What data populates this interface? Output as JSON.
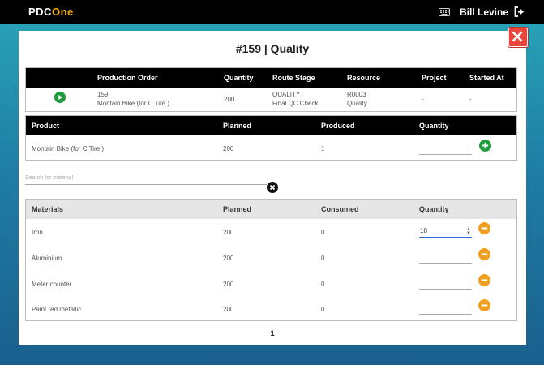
{
  "app": {
    "logo_left": "PDC",
    "logo_right": "One",
    "user_name": "Bill Levine"
  },
  "modal": {
    "title": "#159 | Quality"
  },
  "order_table": {
    "headers": [
      "Production Order",
      "Quantity",
      "Route Stage",
      "Resource",
      "Project",
      "Started At"
    ],
    "row": {
      "order_id": "159",
      "order_name": "Montain Bike (for C.Tire )",
      "quantity": "200",
      "route_stage_1": "QUALITY",
      "route_stage_2": "Final QC Check",
      "resource_1": "R0003",
      "resource_2": "Quality",
      "project": "-",
      "started_at": "-"
    }
  },
  "product_table": {
    "headers": [
      "Product",
      "Planned",
      "Produced",
      "Quantity"
    ],
    "row": {
      "product": "Montain Bike (for C.Tire )",
      "planned": "200",
      "produced": "1",
      "quantity": ""
    }
  },
  "search": {
    "placeholder": "Search for material"
  },
  "materials_table": {
    "headers": [
      "Materials",
      "Planned",
      "Consumed",
      "Quantity"
    ],
    "rows": [
      {
        "material": "Iron",
        "planned": "200",
        "consumed": "0",
        "quantity": "10"
      },
      {
        "material": "Aluminium",
        "planned": "200",
        "consumed": "0",
        "quantity": ""
      },
      {
        "material": "Meter counter",
        "planned": "200",
        "consumed": "0",
        "quantity": ""
      },
      {
        "material": "Paint red metallic",
        "planned": "200",
        "consumed": "0",
        "quantity": ""
      }
    ]
  },
  "pagination": {
    "current_page": "1"
  },
  "colors": {
    "header_bg": "#000000",
    "accent_green": "#1e9b3c",
    "accent_orange": "#f0a020",
    "close_red": "#e8453c"
  },
  "icons": {
    "keyboard": "keyboard-icon",
    "logout": "logout-icon",
    "close": "close-icon",
    "play": "play-icon",
    "add": "plus-circle-icon",
    "clear": "clear-circle-icon",
    "remove": "minus-circle-icon"
  }
}
